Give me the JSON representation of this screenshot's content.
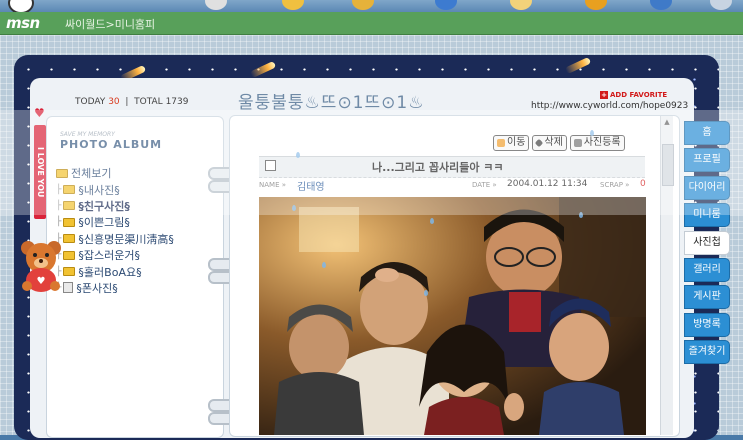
{
  "app": {
    "logo": "msn",
    "breadcrumb": "싸이월드>미니홈피"
  },
  "counter": {
    "today_label": "TODAY",
    "today_value": "30",
    "total_label": "TOTAL",
    "total_value": "1739"
  },
  "album": {
    "subtitle": "SAVE MY MEMORY",
    "title": "PHOTO ALBUM",
    "folders": [
      {
        "label": "전체보기",
        "type": "root"
      },
      {
        "label": "§내사진§",
        "type": "folder"
      },
      {
        "label": "§친구사진§",
        "type": "folder",
        "selected": true
      },
      {
        "label": "§이쁜그림§",
        "type": "folder"
      },
      {
        "label": "§신흥명문渠川淸高§",
        "type": "folder"
      },
      {
        "label": "§잡스러운거§",
        "type": "folder"
      },
      {
        "label": "§홀러BoA요§",
        "type": "folder"
      },
      {
        "label": "§폰사진§",
        "type": "phone"
      }
    ]
  },
  "ribbon_text": "I LOVE YOU",
  "header": {
    "site_title": "울퉁불퉁♨뜨⊙1뜨⊙1♨",
    "add_favorite": "ADD FAVORITE",
    "url": "http://www.cyworld.com/hope0923"
  },
  "actions": {
    "move": "이동",
    "delete": "삭제",
    "register": "사진등록"
  },
  "post": {
    "title": "나...그리고 꼽사리들아 ㅋㅋ",
    "name_label": "NAME »",
    "name_value": "김태영",
    "date_label": "DATE »",
    "date_value": "2004.01.12 11:34",
    "scrap_label": "SCRAP »",
    "scrap_value": "0"
  },
  "tabs": [
    {
      "label": "홈"
    },
    {
      "label": "프로필"
    },
    {
      "label": "다이어리"
    },
    {
      "label": "미니룸"
    },
    {
      "label": "사진첩",
      "active": true
    },
    {
      "label": "갤러리"
    },
    {
      "label": "게시판"
    },
    {
      "label": "방명록"
    },
    {
      "label": "즐겨찾기"
    }
  ],
  "colors": {
    "msn_bar": "#58a05a",
    "frame_navy": "#1b2a57",
    "tab_blue": "#2c8fd4",
    "accent_red": "#d9233a"
  }
}
